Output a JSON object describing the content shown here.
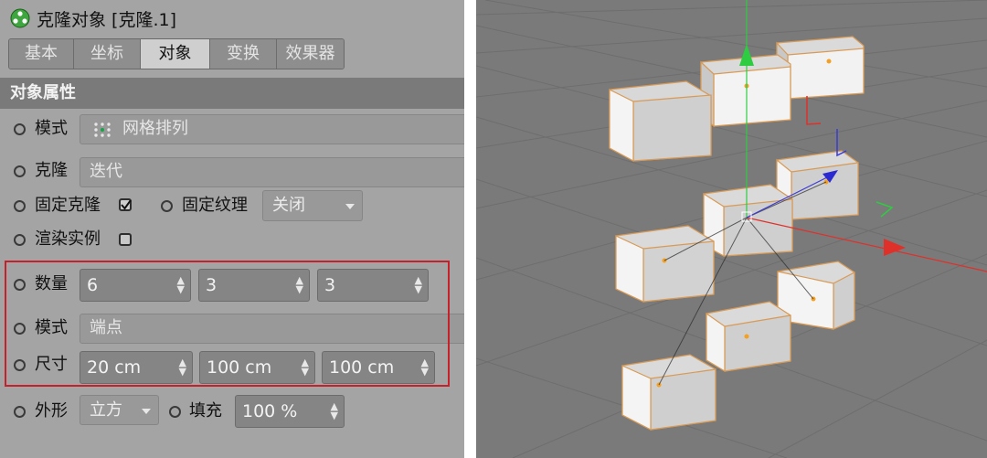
{
  "header": {
    "title": "克隆对象 [克隆.1]"
  },
  "tabs": [
    {
      "label": "基本",
      "active": false
    },
    {
      "label": "坐标",
      "active": false
    },
    {
      "label": "对象",
      "active": true
    },
    {
      "label": "变换",
      "active": false
    },
    {
      "label": "效果器",
      "active": false
    }
  ],
  "section": {
    "title": "对象属性"
  },
  "mode": {
    "label": "模式",
    "value": "网格排列"
  },
  "clone": {
    "label": "克隆",
    "value": "迭代"
  },
  "fixed_clone": {
    "label": "固定克隆",
    "checked": true
  },
  "fixed_texture": {
    "label": "固定纹理",
    "value": "关闭"
  },
  "render_instance": {
    "label": "渲染实例",
    "checked": false
  },
  "count": {
    "label": "数量",
    "values": [
      "6",
      "3",
      "3"
    ]
  },
  "mode2": {
    "label": "模式",
    "value": "端点"
  },
  "size": {
    "label": "尺寸",
    "values": [
      "20 cm",
      "100 cm",
      "100 cm"
    ]
  },
  "shape": {
    "label": "外形",
    "value": "立方"
  },
  "fill": {
    "label": "填充",
    "value": "100 %"
  },
  "colors": {
    "panel": "#a4a4a4",
    "header": "#7a7a7a",
    "highlight": "#c8202a",
    "viewport": "#7a7a7a",
    "axis_x": "#e0302a",
    "axis_y": "#2ecc40",
    "axis_z": "#3a3ad8"
  }
}
